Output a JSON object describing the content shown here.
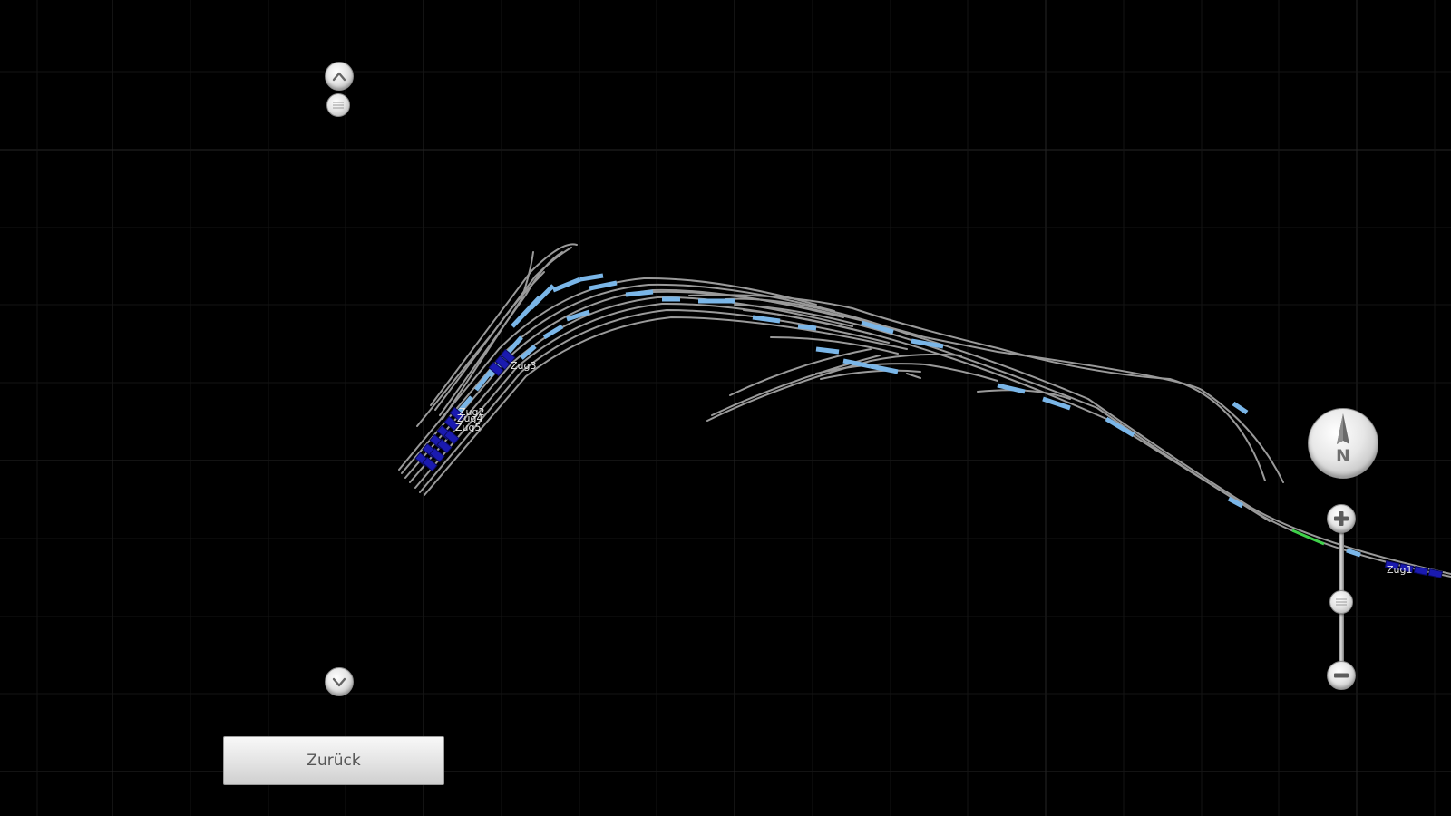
{
  "map": {
    "background": "#000000",
    "grid_color": "#2a2a2a",
    "track_color": "#9a9a9a",
    "occupied_color": "#7ab6e8",
    "train_color": "#1a1ab0",
    "route_color": "#3fd14a",
    "label_color": "#e8e8e8"
  },
  "trains": [
    {
      "label": "Zug3"
    },
    {
      "label": "Zug2"
    },
    {
      "label": "Zug4"
    },
    {
      "label": "Zug5"
    },
    {
      "label": "Zug1"
    }
  ],
  "compass": {
    "letter": "N",
    "icon": "north-arrow-icon"
  },
  "controls": {
    "scroll_up_icon": "chevron-up-icon",
    "scroll_down_icon": "chevron-down-icon",
    "zoom_in_icon": "plus-icon",
    "zoom_out_icon": "minus-icon"
  },
  "back_button": {
    "label": "Zurück"
  }
}
